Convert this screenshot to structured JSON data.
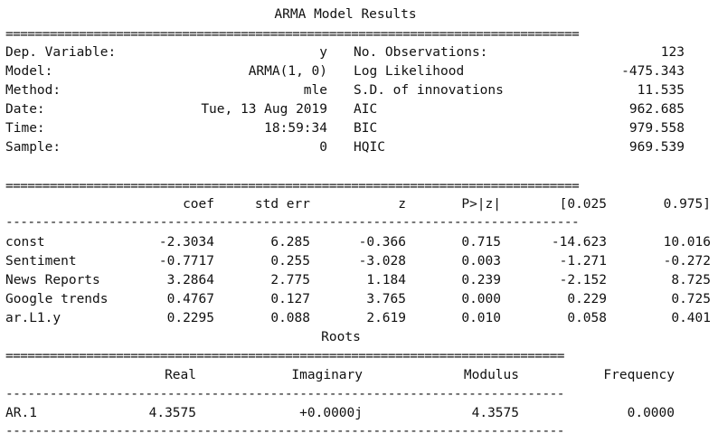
{
  "title": "ARMA Model Results",
  "double_rule": "==============================================================================",
  "double_rule_short": "============================================================================",
  "single_rule": "------------------------------------------------------------------------------",
  "single_rule_short": "----------------------------------------------------------------------------",
  "summary": {
    "left": [
      {
        "label": "Dep. Variable:",
        "value": "y"
      },
      {
        "label": "Model:",
        "value": "ARMA(1, 0)"
      },
      {
        "label": "Method:",
        "value": "mle"
      },
      {
        "label": "Date:",
        "value": "Tue, 13 Aug 2019"
      },
      {
        "label": "Time:",
        "value": "18:59:34"
      },
      {
        "label": "Sample:",
        "value": "0"
      }
    ],
    "right": [
      {
        "label": "No. Observations:",
        "value": "123"
      },
      {
        "label": "Log Likelihood",
        "value": "-475.343"
      },
      {
        "label": "S.D. of innovations",
        "value": "11.535"
      },
      {
        "label": "AIC",
        "value": "962.685"
      },
      {
        "label": "BIC",
        "value": "979.558"
      },
      {
        "label": "HQIC",
        "value": "969.539"
      }
    ]
  },
  "coef_table": {
    "headers": [
      "coef",
      "std err",
      "z",
      "P>|z|",
      "[0.025",
      "0.975]"
    ],
    "rows": [
      {
        "name": "const",
        "values": [
          "-2.3034",
          "6.285",
          "-0.366",
          "0.715",
          "-14.623",
          "10.016"
        ]
      },
      {
        "name": "Sentiment",
        "values": [
          "-0.7717",
          "0.255",
          "-3.028",
          "0.003",
          "-1.271",
          "-0.272"
        ]
      },
      {
        "name": "News Reports",
        "values": [
          "3.2864",
          "2.775",
          "1.184",
          "0.239",
          "-2.152",
          "8.725"
        ]
      },
      {
        "name": "Google trends",
        "values": [
          "0.4767",
          "0.127",
          "3.765",
          "0.000",
          "0.229",
          "0.725"
        ]
      },
      {
        "name": "ar.L1.y",
        "values": [
          "0.2295",
          "0.088",
          "2.619",
          "0.010",
          "0.058",
          "0.401"
        ]
      }
    ]
  },
  "roots": {
    "title": "Roots",
    "headers": [
      "Real",
      "Imaginary",
      "Modulus",
      "Frequency"
    ],
    "rows": [
      {
        "name": "AR.1",
        "values": [
          "4.3575",
          "+0.0000j",
          "4.3575",
          "0.0000"
        ]
      }
    ]
  }
}
